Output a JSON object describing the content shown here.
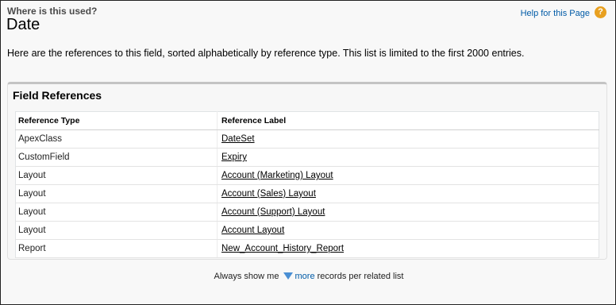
{
  "header": {
    "subtitle": "Where is this used?",
    "title": "Date",
    "help_link": "Help for this Page",
    "help_icon": "question-icon",
    "help_icon_glyph": "?"
  },
  "description": "Here are the references to this field, sorted alphabetically by reference type. This list is limited to the first 2000 entries.",
  "panel": {
    "title": "Field References",
    "columns": [
      "Reference Type",
      "Reference Label"
    ],
    "rows": [
      {
        "type": "ApexClass",
        "label": "DateSet"
      },
      {
        "type": "CustomField",
        "label": "Expiry"
      },
      {
        "type": "Layout",
        "label": "Account (Marketing) Layout"
      },
      {
        "type": "Layout",
        "label": "Account (Sales) Layout"
      },
      {
        "type": "Layout",
        "label": "Account (Support) Layout"
      },
      {
        "type": "Layout",
        "label": "Account Layout"
      },
      {
        "type": "Report",
        "label": "New_Account_History_Report"
      }
    ]
  },
  "footer": {
    "prefix": "Always show me",
    "more_link": "more",
    "suffix": "records per related list",
    "more_icon": "triangle-down-icon"
  },
  "colors": {
    "link": "#015ba7",
    "help_icon": "#e8a020",
    "triangle": "#4a8fd4"
  }
}
